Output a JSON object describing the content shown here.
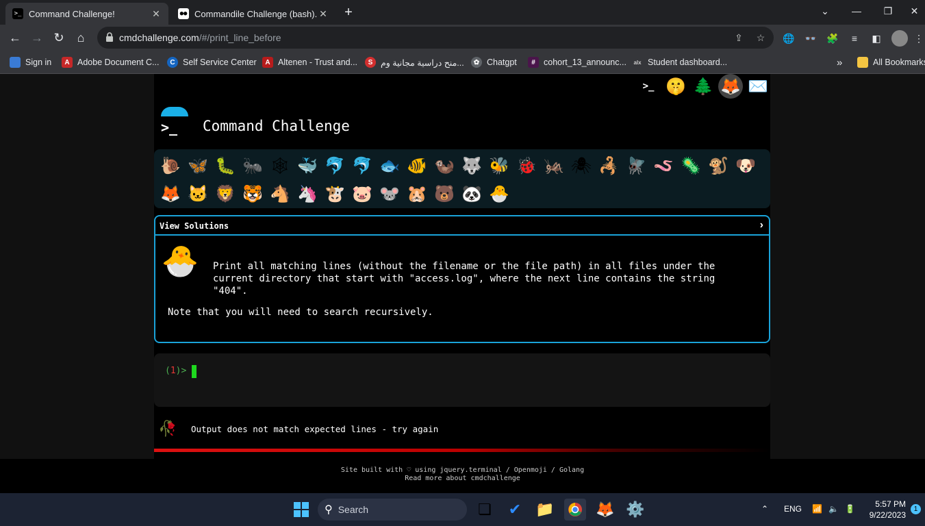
{
  "browser": {
    "tabs": [
      {
        "title": "Command Challenge!",
        "active": true
      },
      {
        "title": "Commandile Challenge (bash). T",
        "active": false
      }
    ],
    "url_host": "cmdchallenge.com",
    "url_path": "/#/print_line_before",
    "bookmarks": [
      {
        "label": "Sign in",
        "icon": "m365-icon"
      },
      {
        "label": "Adobe Document C...",
        "icon": "adobe-icon"
      },
      {
        "label": "Self Service Center",
        "icon": "c-logo-icon"
      },
      {
        "label": "Altenen - Trust and...",
        "icon": "altenen-icon"
      },
      {
        "label": "منح دراسية مجانية وم...",
        "icon": "s-logo-icon"
      },
      {
        "label": "Chatgpt",
        "icon": "chatgpt-icon"
      },
      {
        "label": "cohort_13_announc...",
        "icon": "slack-icon"
      },
      {
        "label": "Student dashboard...",
        "icon": "alx-icon"
      }
    ],
    "bookmarks_more": "»",
    "all_bookmarks": "All Bookmarks"
  },
  "site": {
    "title": "Command Challenge",
    "logo_prompt": ">_",
    "top_icons": [
      "terminal-icon",
      "shushing-face-icon",
      "tree-icon",
      "gitlab-icon",
      "envelope-icon"
    ],
    "emoji_row1": [
      "🐌",
      "🦋",
      "🐛",
      "🐜",
      "🕸",
      "🐳",
      "🐬",
      "🐬",
      "🐟",
      "🐠",
      "🦦",
      "🐺",
      "🐝",
      "🐞",
      "🦗",
      "🕷",
      "🦂",
      "🪰",
      "🪱",
      "🦠",
      "🐒",
      "🐶"
    ],
    "emoji_row2": [
      "🦊",
      "🐱",
      "🦁",
      "🐯",
      "🐴",
      "🦄",
      "🐮",
      "🐷",
      "🐭",
      "🐹",
      "🐻",
      "🐼",
      "🐣"
    ]
  },
  "solutions": {
    "label": "View Solutions",
    "chevron": "›",
    "description": "Print all matching lines (without the filename or the file path) in all files under the current directory that start with \"access.log\", where the next line contains the string \"404\".",
    "note": "Note that you will need to search recursively."
  },
  "terminal": {
    "prompt_open": "(",
    "prompt_num": "1",
    "prompt_close": ")>"
  },
  "result": {
    "message": "Output does not match expected lines - try again"
  },
  "footer": {
    "line1": "Site built with ♡ using jquery.terminal / Openmoji / Golang",
    "line2": "Read more about cmdchallenge"
  },
  "taskbar": {
    "search_label": "Search",
    "lang": "ENG",
    "time": "5:57 PM",
    "date": "9/22/2023",
    "notifications": "1"
  }
}
